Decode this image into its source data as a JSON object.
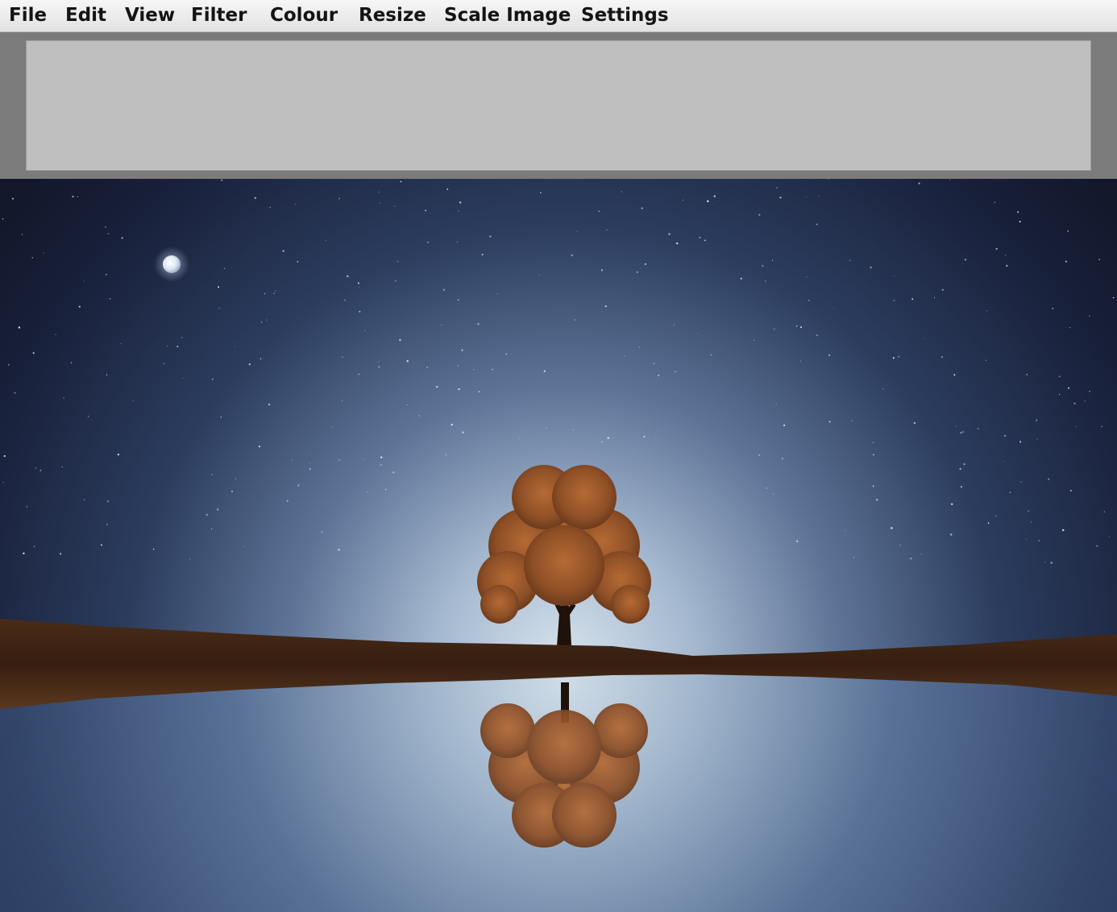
{
  "menubar": {
    "items": [
      {
        "label": "File"
      },
      {
        "label": "Edit"
      },
      {
        "label": "View"
      },
      {
        "label": "Filter"
      },
      {
        "label": "Colour"
      },
      {
        "label": "Resize"
      },
      {
        "label": "Scale Image"
      },
      {
        "label": "Settings"
      }
    ]
  },
  "toolbar": {
    "panel_color": "#bfbfbf",
    "background_color": "#7b7b7b"
  },
  "image": {
    "subject": "night sky with moon, lone autumn tree on a strip of land reflected in still water",
    "colors": {
      "sky_top": "#141a2e",
      "sky_horizon": "#c3d3e0",
      "tree_foliage": "#9c5a2c",
      "land": "#3e2414",
      "water": "#4c6a92"
    }
  }
}
